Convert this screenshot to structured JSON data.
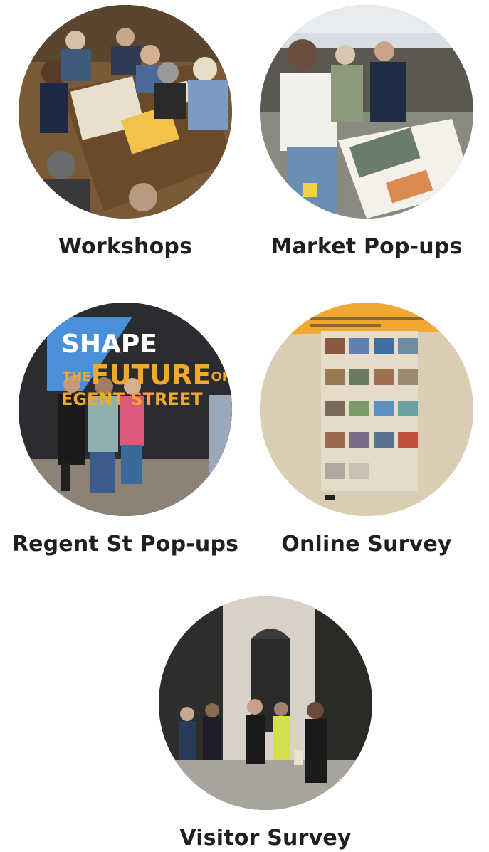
{
  "items": [
    {
      "id": "workshops",
      "label": "Workshops"
    },
    {
      "id": "market",
      "label": "Market Pop-ups"
    },
    {
      "id": "regent",
      "label": "Regent St Pop-ups",
      "sign": {
        "line1": "SHAPE",
        "line2_prefix": "THE",
        "line2": "FUTURE",
        "line2_suffix": "OF",
        "line3": "EGENT STREET"
      }
    },
    {
      "id": "online",
      "label": "Online Survey"
    },
    {
      "id": "visitor",
      "label": "Visitor Survey"
    }
  ],
  "colors": {
    "caption": "#1f1f1f",
    "accent_orange": "#f0a830",
    "survey_bg": "#d9cdb3",
    "sign_blue": "#4a90d9"
  }
}
